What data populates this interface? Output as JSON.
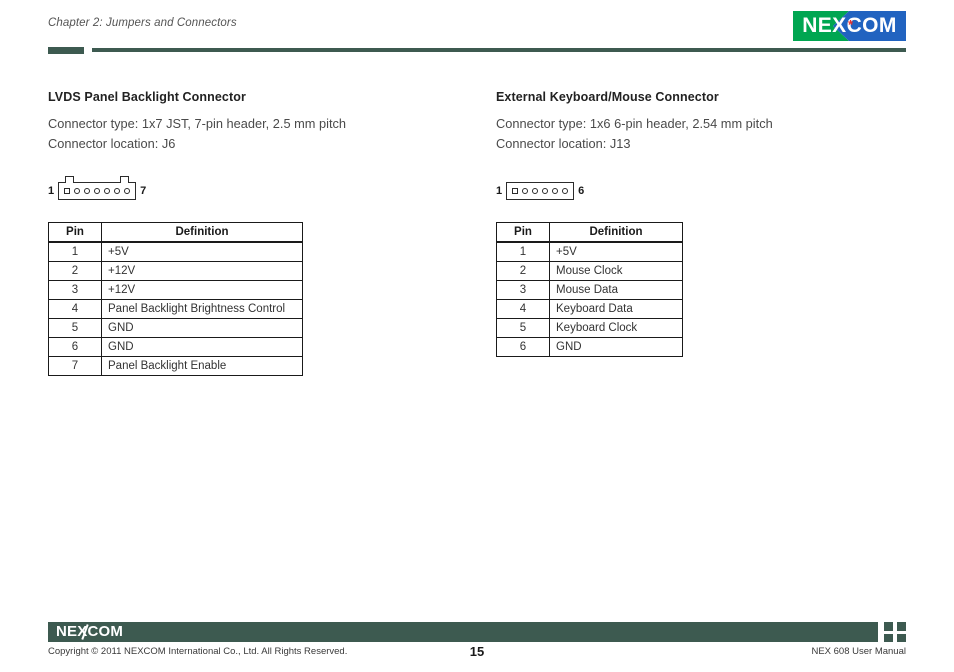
{
  "header": {
    "chapter": "Chapter 2: Jumpers and Connectors",
    "logo_text": "NEXCOM",
    "logo_star": "*",
    "logo_green": "#00a651",
    "logo_blue": "#2163c0",
    "logo_star_color": "#e8302a",
    "rule_color": "#3d5a50"
  },
  "sections": [
    {
      "title": "LVDS Panel Backlight Connector",
      "connector_type": "Connector type: 1x7 JST, 7-pin header, 2.5 mm pitch",
      "connector_location": "Connector location: J6",
      "diagram": {
        "start_label": "1",
        "end_label": "7",
        "pin_count": 7,
        "has_tabs": true
      },
      "table": {
        "columns": [
          "Pin",
          "Definition"
        ],
        "rows": [
          {
            "pin": "1",
            "definition": "+5V"
          },
          {
            "pin": "2",
            "definition": "+12V"
          },
          {
            "pin": "3",
            "definition": "+12V"
          },
          {
            "pin": "4",
            "definition": "Panel Backlight Brightness Control"
          },
          {
            "pin": "5",
            "definition": "GND"
          },
          {
            "pin": "6",
            "definition": "GND"
          },
          {
            "pin": "7",
            "definition": "Panel Backlight Enable"
          }
        ]
      }
    },
    {
      "title": "External Keyboard/Mouse Connector",
      "connector_type": "Connector type: 1x6 6-pin header, 2.54 mm pitch",
      "connector_location": "Connector location: J13",
      "diagram": {
        "start_label": "1",
        "end_label": "6",
        "pin_count": 6,
        "has_tabs": false
      },
      "table": {
        "columns": [
          "Pin",
          "Definition"
        ],
        "rows": [
          {
            "pin": "1",
            "definition": "+5V"
          },
          {
            "pin": "2",
            "definition": "Mouse Clock"
          },
          {
            "pin": "3",
            "definition": "Mouse Data"
          },
          {
            "pin": "4",
            "definition": "Keyboard Data"
          },
          {
            "pin": "5",
            "definition": "Keyboard Clock"
          },
          {
            "pin": "6",
            "definition": "GND"
          }
        ]
      }
    }
  ],
  "footer": {
    "logo_text": "NEXCOM",
    "copyright": "Copyright © 2011 NEXCOM International Co., Ltd. All Rights Reserved.",
    "page_number": "15",
    "manual_name": "NEX 608 User Manual",
    "bar_color": "#3d5a50"
  }
}
